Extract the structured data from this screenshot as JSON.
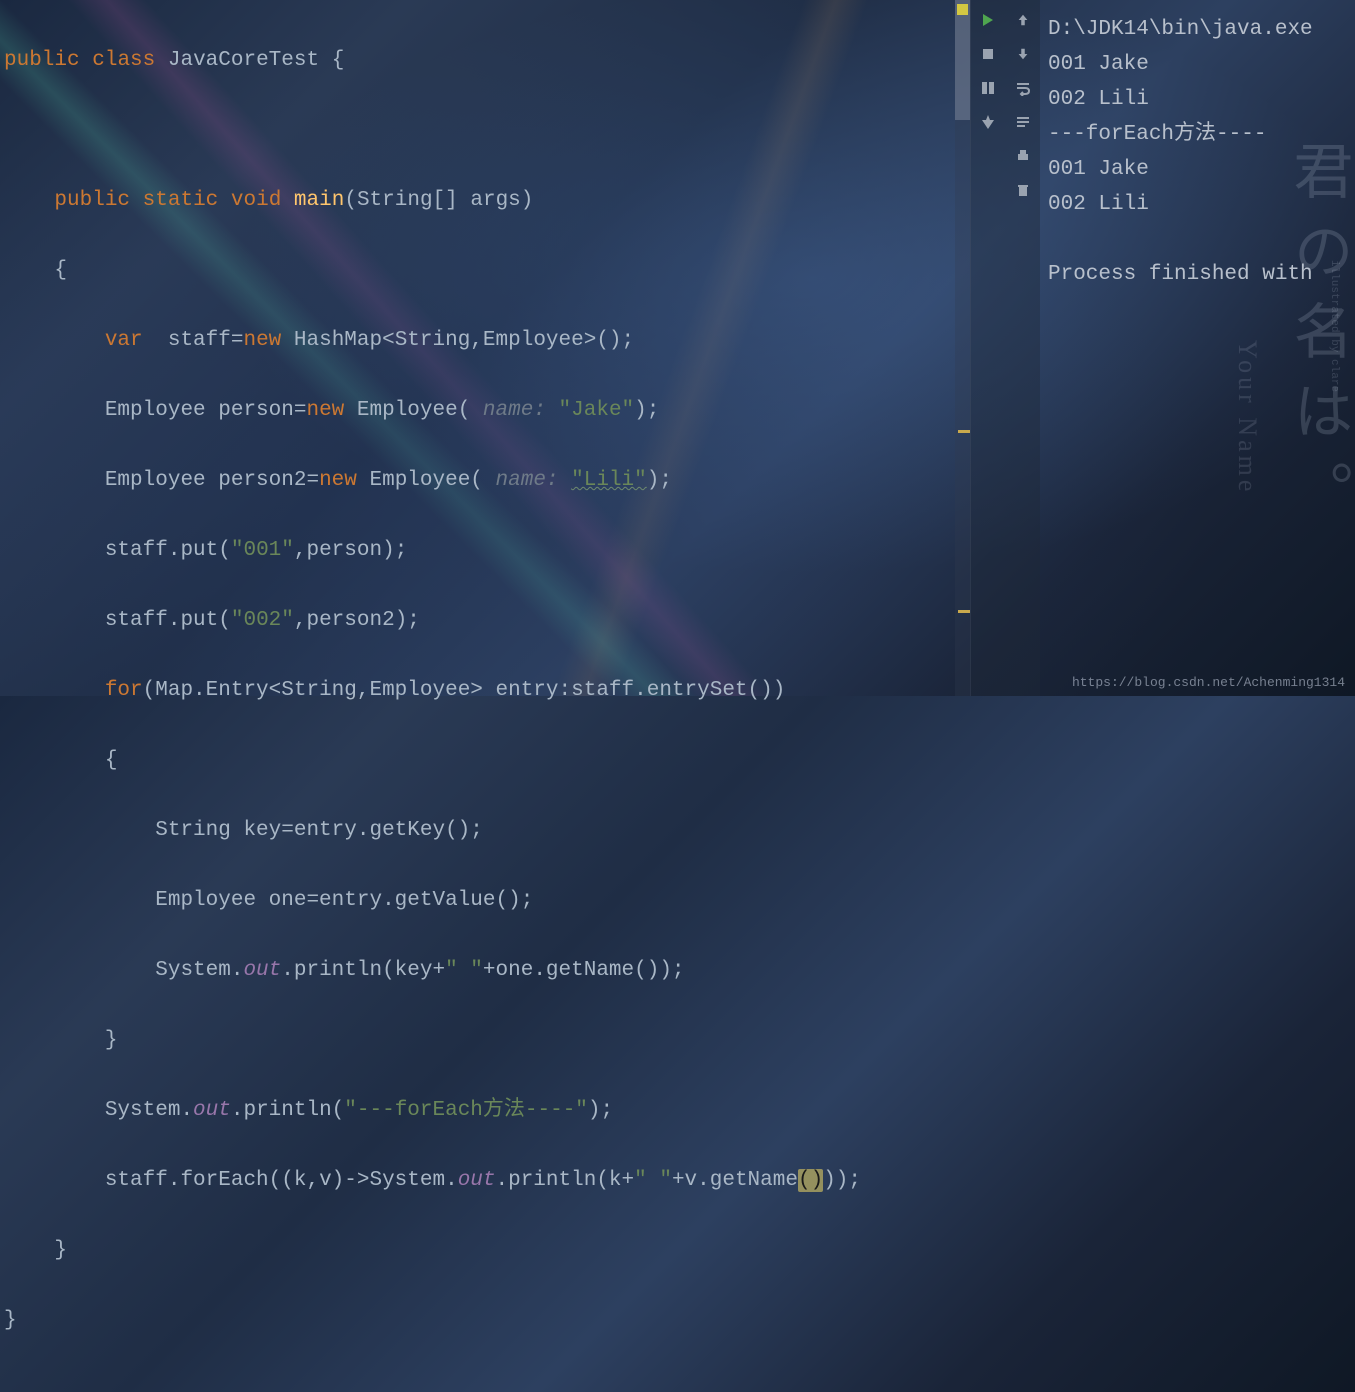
{
  "code": {
    "class_decl_public": "public",
    "class_decl_class": "class",
    "class_name": "JavaCoreTest",
    "method_public": "public",
    "method_static": "static",
    "method_void": "void",
    "method_name": "main",
    "method_params": "(String[] args)",
    "var_kw": "var",
    "var_line": "  staff=",
    "new_kw": "new",
    "hashmap": " HashMap<String,Employee>();",
    "emp1_type": "Employee person=",
    "emp1_new": "new",
    "emp1_call": " Employee(",
    "hint_name": " name: ",
    "emp1_str": "\"Jake\"",
    "emp1_end": ");",
    "emp2_type": "Employee person2=",
    "emp2_new": "new",
    "emp2_call": " Employee(",
    "emp2_str": "\"Lili\"",
    "emp2_end": ");",
    "put1_a": "staff.put(",
    "put1_str": "\"001\"",
    "put1_b": ",person);",
    "put2_a": "staff.put(",
    "put2_str": "\"002\"",
    "put2_b": ",person2);",
    "for_kw": "for",
    "for_body": "(Map.Entry<String,Employee> entry:staff.entrySet())",
    "key_line": "String key=entry.getKey();",
    "one_line": "Employee one=entry.getValue();",
    "sys": "System.",
    "out": "out",
    "println1": ".println(key+",
    "space_str": "\" \"",
    "println1_end": "+one.getName());",
    "println2a": ".println(",
    "foreach_str": "\"---forEach方法----\"",
    "println2b": ");",
    "foreach_line_a": "staff.forEach((k,v)->System.",
    "foreach_line_b": ".println(k+",
    "foreach_line_c": "+v.getName",
    "paren_hl": "()",
    "foreach_line_d": "));"
  },
  "console": {
    "line1": "D:\\JDK14\\bin\\java.exe",
    "line2": "001 Jake",
    "line3": "002 Lili",
    "line4": "---forEach方法----",
    "line5": "001 Jake",
    "line6": "002 Lili",
    "line7": "Process finished with"
  },
  "watermark": {
    "jp": "君の名は。",
    "en": "Your Name",
    "small": "illustrated by clare"
  },
  "footer": "https://blog.csdn.net/Achenming1314"
}
